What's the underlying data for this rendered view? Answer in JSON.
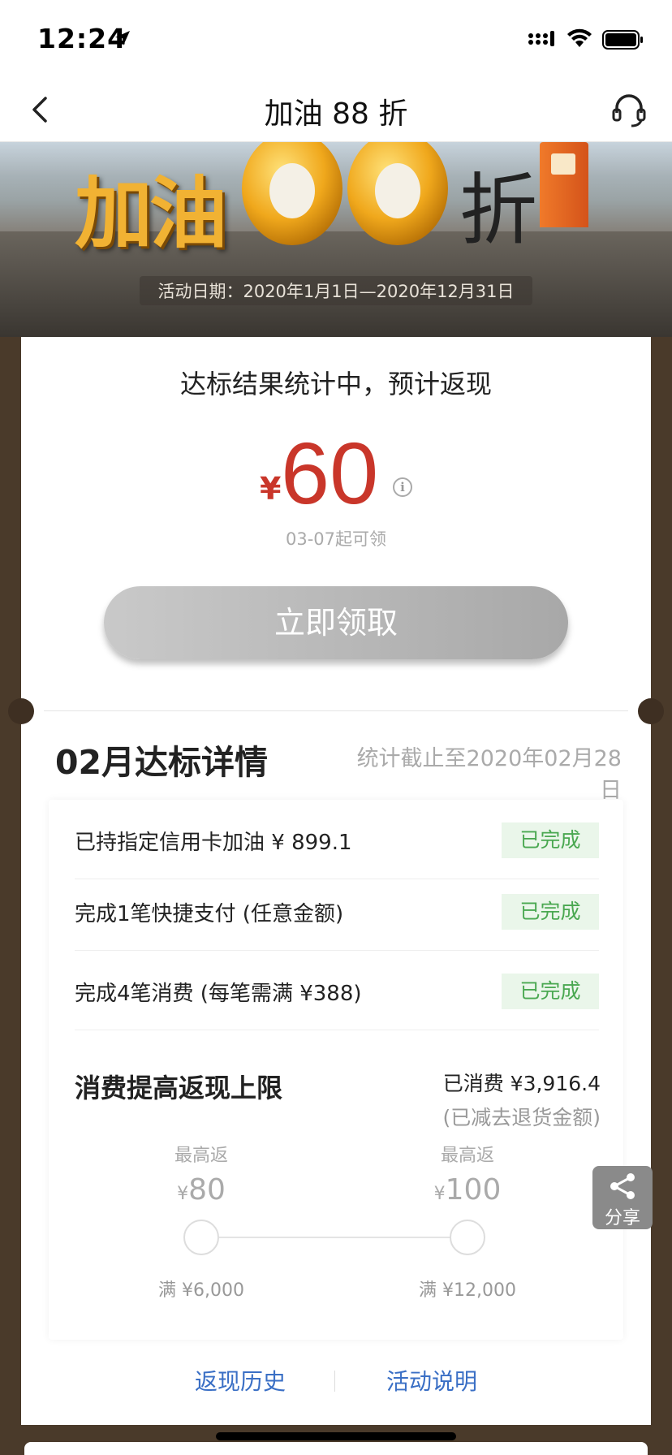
{
  "status_bar": {
    "time": "12:24"
  },
  "nav": {
    "title": "加油 88 折"
  },
  "banner": {
    "headline": "加油",
    "big_number": "88",
    "discount_char": "折",
    "date_range": "活动日期：2020年1月1日—2020年12月31日"
  },
  "result": {
    "title": "达标结果统计中，预计返现",
    "currency": "¥",
    "amount": "60",
    "available": "03-07起可领",
    "claim_button": "立即领取"
  },
  "month_detail": {
    "title": "02月达标详情",
    "cutoff": "统计截止至2020年02月28日",
    "requirements": [
      {
        "label": "已持指定信用卡加油 ¥ 899.1",
        "status": "已完成"
      },
      {
        "label": "完成1笔快捷支付 (任意金额)",
        "status": "已完成"
      },
      {
        "label": "完成4笔消费 (每笔需满 ¥388)",
        "status": "已完成"
      }
    ],
    "raise": {
      "title": "消费提高返现上限",
      "spent": "已消费 ¥3,916.4",
      "note": "(已减去退货金额)",
      "tiers": [
        {
          "cap_label": "最高返",
          "currency": "¥",
          "amount": "80",
          "condition": "满 ¥6,000"
        },
        {
          "cap_label": "最高返",
          "currency": "¥",
          "amount": "100",
          "condition": "满 ¥12,000"
        }
      ]
    }
  },
  "links": {
    "history": "返现历史",
    "rules": "活动说明"
  },
  "share": {
    "label": "分享"
  },
  "colors": {
    "accent_red": "#c9362a",
    "link_blue": "#3a6fc5",
    "done_green": "#4aa851",
    "frame_brown": "#4a3a2a"
  }
}
